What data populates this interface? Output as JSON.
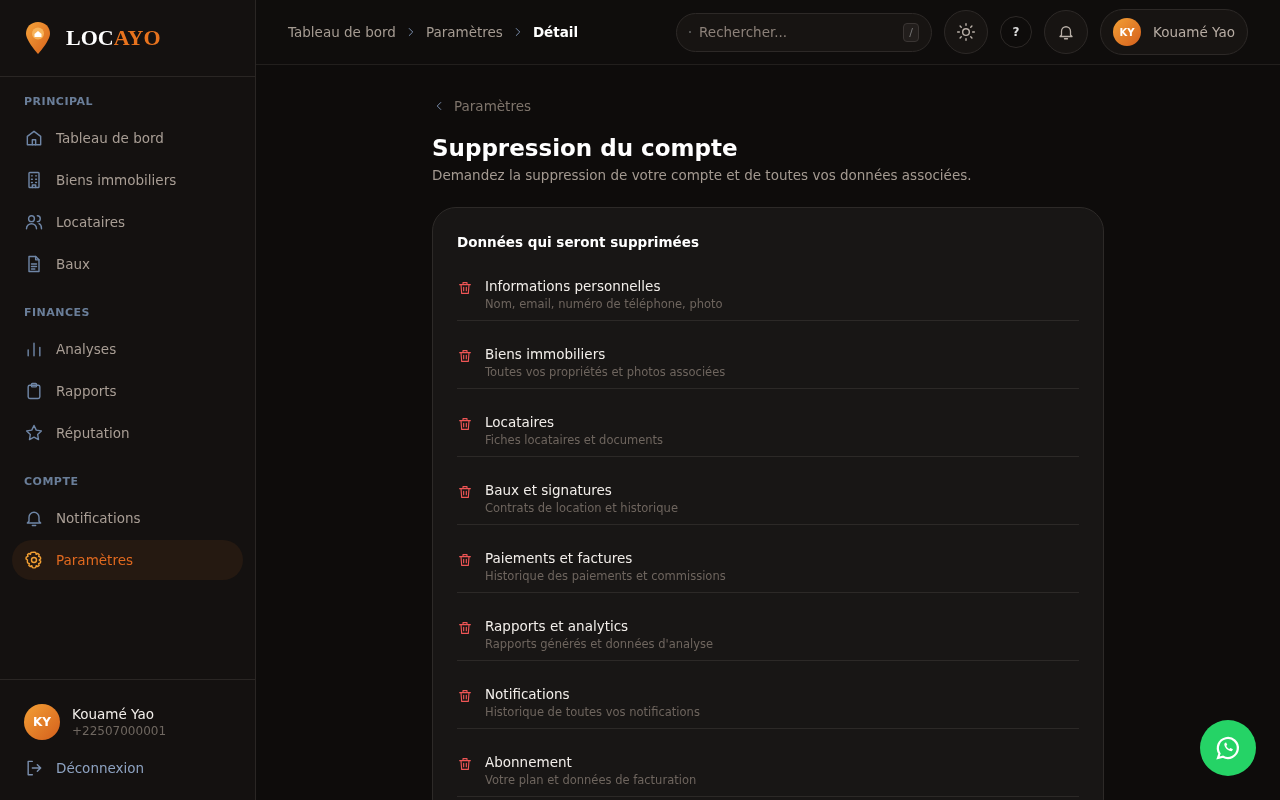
{
  "logo": {
    "first": "LOC",
    "accent": "AYO"
  },
  "sidebar": {
    "sections": [
      {
        "title": "PRINCIPAL",
        "items": [
          {
            "label": "Tableau de bord",
            "selected": false
          },
          {
            "label": "Biens immobiliers",
            "selected": false
          },
          {
            "label": "Locataires",
            "selected": false
          },
          {
            "label": "Baux",
            "selected": false
          }
        ]
      },
      {
        "title": "FINANCES",
        "items": [
          {
            "label": "Analyses",
            "selected": false
          },
          {
            "label": "Rapports",
            "selected": false
          },
          {
            "label": "Réputation",
            "selected": false
          }
        ]
      },
      {
        "title": "COMPTE",
        "items": [
          {
            "label": "Notifications",
            "selected": false
          },
          {
            "label": "Paramètres",
            "selected": true
          }
        ]
      }
    ],
    "user": {
      "initials": "KY",
      "name": "Kouamé Yao",
      "phone": "+22507000001"
    },
    "logout": "Déconnexion"
  },
  "header": {
    "breadcrumbs": [
      "Tableau de bord",
      "Paramètres",
      "Détail"
    ],
    "search": {
      "placeholder": "Rechercher...",
      "shortcut": "/"
    },
    "help": "?",
    "user": {
      "initials": "KY",
      "name": "Kouamé Yao"
    }
  },
  "back_link": "Paramètres",
  "title": "Suppression du compte",
  "subtitle": "Demandez la suppression de votre compte et de toutes vos données associées.",
  "card": {
    "title": "Données qui seront supprimées",
    "items": [
      {
        "title": "Informations personnelles",
        "description": "Nom, email, numéro de téléphone, photo"
      },
      {
        "title": "Biens immobiliers",
        "description": "Toutes vos propriétés et photos associées"
      },
      {
        "title": "Locataires",
        "description": "Fiches locataires et documents"
      },
      {
        "title": "Baux et signatures",
        "description": "Contrats de location et historique"
      },
      {
        "title": "Paiements et factures",
        "description": "Historique des paiements et commissions"
      },
      {
        "title": "Rapports et analytics",
        "description": "Rapports générés et données d'analyse"
      },
      {
        "title": "Notifications",
        "description": "Historique de toutes vos notifications"
      },
      {
        "title": "Abonnement",
        "description": "Votre plan et données de facturation"
      }
    ]
  }
}
